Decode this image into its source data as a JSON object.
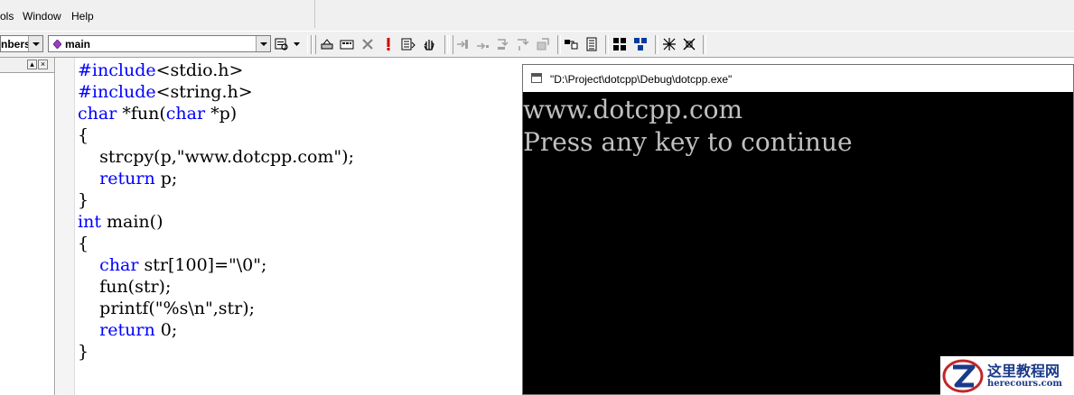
{
  "menu": {
    "items": [
      {
        "label": "ols"
      },
      {
        "label": "Window"
      },
      {
        "label": "Help"
      }
    ]
  },
  "toolbar": {
    "members_combo": "nbers",
    "function_combo": "main"
  },
  "editor": {
    "lines": [
      [
        {
          "t": "#include",
          "k": true
        },
        {
          "t": "<stdio.h>"
        }
      ],
      [
        {
          "t": "#include",
          "k": true
        },
        {
          "t": "<string.h>"
        }
      ],
      [
        {
          "t": "char",
          "k": true
        },
        {
          "t": " *fun("
        },
        {
          "t": "char",
          "k": true
        },
        {
          "t": " *p)"
        }
      ],
      [
        {
          "t": "{"
        }
      ],
      [
        {
          "t": "    strcpy(p,\"www.dotcpp.com\");"
        }
      ],
      [
        {
          "t": "    "
        },
        {
          "t": "return",
          "k": true
        },
        {
          "t": " p;"
        }
      ],
      [
        {
          "t": "}"
        }
      ],
      [
        {
          "t": "int",
          "k": true
        },
        {
          "t": " main()"
        }
      ],
      [
        {
          "t": "{"
        }
      ],
      [
        {
          "t": "    "
        },
        {
          "t": "char",
          "k": true
        },
        {
          "t": " str[100]=\"\\0\";"
        }
      ],
      [
        {
          "t": "    fun(str);"
        }
      ],
      [
        {
          "t": "    printf(\"%s\\n\",str);"
        }
      ],
      [
        {
          "t": "    "
        },
        {
          "t": "return",
          "k": true
        },
        {
          "t": " 0;"
        }
      ],
      [
        {
          "t": "}"
        }
      ]
    ]
  },
  "console": {
    "title": "\"D:\\Project\\dotcpp\\Debug\\dotcpp.exe\"",
    "output_line_1": "www.dotcpp.com",
    "output_line_2": "Press any key to continue"
  },
  "watermark": {
    "chinese": "这里教程网",
    "domain": "herecours.com"
  },
  "colors": {
    "keyword": "#0000ff",
    "console_bg": "#000000",
    "console_text": "#c0c0c0",
    "watermark": "#1a3a8a"
  }
}
